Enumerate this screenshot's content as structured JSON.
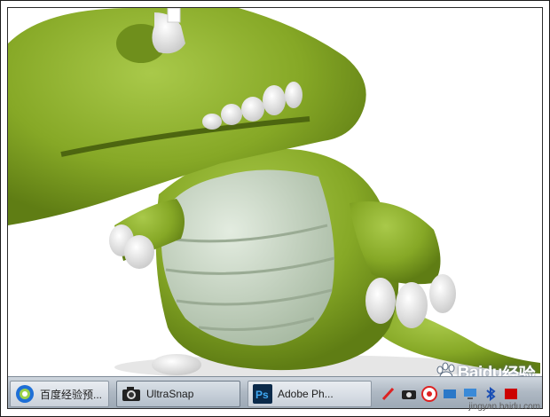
{
  "taskbar": {
    "tasks": [
      {
        "label": "百度经验预...",
        "icon": "baidu-browser-icon"
      },
      {
        "label": "UltraSnap",
        "icon": "camera-icon"
      },
      {
        "label": "Adobe Ph...",
        "icon": "photoshop-icon"
      }
    ],
    "tray_icons": [
      "red-pen-icon",
      "camera-small-icon",
      "red-badge-icon",
      "network-icon",
      "computer-icon",
      "bluetooth-icon",
      "adobe-icon"
    ]
  },
  "watermark": {
    "brand": "Bai",
    "brand2": "du",
    "suffix": "经验",
    "url": "jingyan.baidu.com"
  },
  "colors": {
    "dino_green": "#8fb32b",
    "belly": "#c8d6c0",
    "taskbar": "#aeb8c3"
  }
}
